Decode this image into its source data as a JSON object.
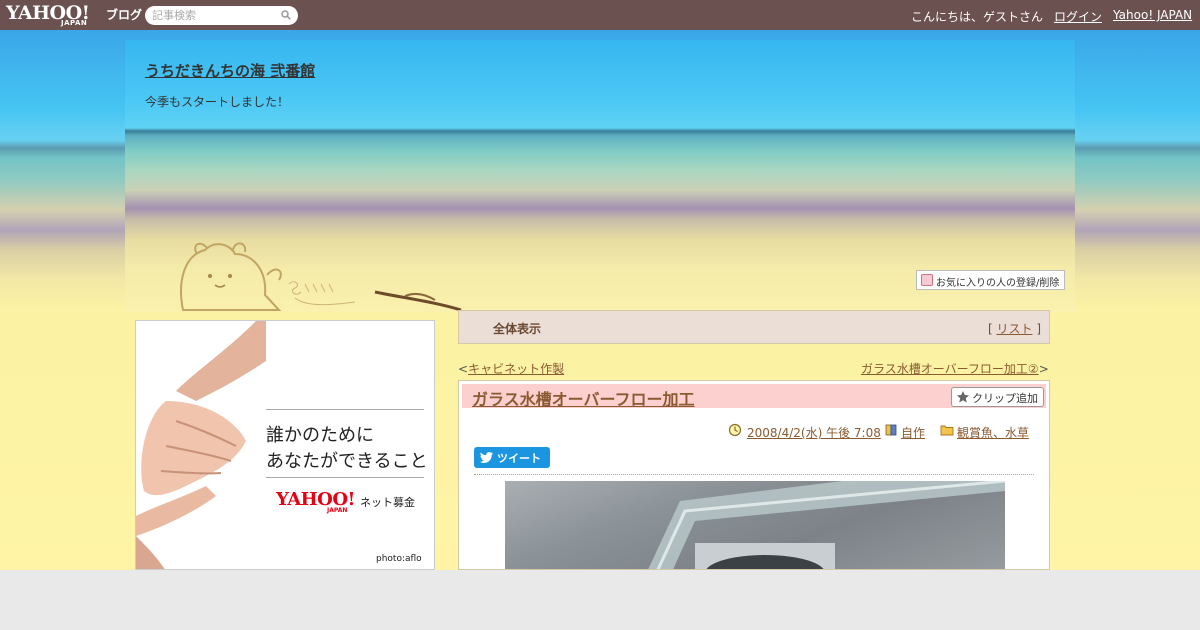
{
  "topbar": {
    "logo_word": "YAHOO!",
    "logo_sub": "JAPAN",
    "logo_blog": "ブログ",
    "search_placeholder": "記事検索",
    "greeting": "こんにちは、ゲストさん",
    "login": "ログイン",
    "yahoo_japan": "Yahoo! JAPAN"
  },
  "header": {
    "blog_title": "うちだきんちの海 弐番館",
    "subtitle": "今季もスタートしました！",
    "fav_button": "お気に入りの人の登録/削除"
  },
  "ad": {
    "line1": "誰かのために",
    "line2": "あなたができること",
    "logo": "YAHOO!",
    "logo_sub": "JAPAN",
    "service": "ネット募金",
    "credit": "photo:aflo"
  },
  "viewbar": {
    "title": "全体表示",
    "bracket_open": "[",
    "list": "リスト",
    "bracket_close": "]"
  },
  "nav": {
    "prev_mark": "<",
    "prev": "キャビネット作製",
    "next": "ガラス水槽オーバーフロー加工②",
    "next_mark": ">"
  },
  "article": {
    "title": "ガラス水槽オーバーフロー加工",
    "clip": "クリップ追加",
    "date": "2008/4/2(水) 午後 7:08",
    "category1": "自作",
    "category2": "観賞魚、水草",
    "tweet": "ツイート"
  },
  "colors": {
    "topbar": "#6b5150",
    "link": "#8a5a31",
    "title_bg": "#fdd0d0",
    "tweet": "#1b95e0"
  }
}
